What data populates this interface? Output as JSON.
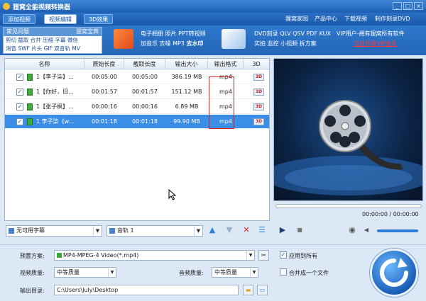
{
  "window": {
    "title": "狸窝全能视频转换器",
    "controls": [
      "_",
      "□",
      "×"
    ]
  },
  "menu": {
    "tabs": [
      "添加视频",
      "视频编辑",
      "3D效果"
    ],
    "links": [
      "狸窝家园",
      "产品中心",
      "下载视频",
      "制作刻录DVD"
    ]
  },
  "banner": {
    "faq_title": "常见问题",
    "faq_right": "狸窝宝典",
    "faq_line1": "剪切 截取 合并 压缩 字幕 微信",
    "faq_line2": "消音 SWF 片头 GIF 双音轨 MV",
    "group1_line1": "电子相册 照片 PPT转视频",
    "group1_line2_a": "加音乐 去噪 MP3",
    "group1_line2_b": "去水印",
    "group2_line1": "DVD刻录 QLV QSV PDF KUX",
    "group2_line2": "实拍 监控 小视频 拆方案",
    "vip_line1": "VIP用户-拥有狸窝所有软件",
    "vip_line2": "点此升级VIP会员"
  },
  "list": {
    "headers": [
      "名称",
      "原始长度",
      "截取长度",
      "输出大小",
      "输出格式",
      "3D"
    ],
    "rows": [
      {
        "name": "1【李子柒】...",
        "orig": "00:05:00",
        "cut": "00:05:00",
        "size": "386.19 MB",
        "fmt": "mp4",
        "selected": false
      },
      {
        "name": "1【你好，旧...",
        "orig": "00:01:57",
        "cut": "00:01:57",
        "size": "151.12 MB",
        "fmt": "mp4",
        "selected": false
      },
      {
        "name": "1【张子枫】...",
        "orig": "00:00:16",
        "cut": "00:00:16",
        "size": "6.89 MB",
        "fmt": "mp4",
        "selected": false
      },
      {
        "name": "1 李子柒《w...",
        "orig": "00:01:18",
        "cut": "00:01:18",
        "size": "99.90 MB",
        "fmt": "mp4",
        "selected": true
      }
    ],
    "badge_3d": "3D"
  },
  "list_tools": {
    "subtitle": "无可用字幕",
    "audio_track": "音轨 1"
  },
  "preview": {
    "time": "00:00:00 / 00:00:00"
  },
  "options": {
    "preset_label": "预置方案:",
    "preset_value": "MP4-MPEG-4 Video(*.mp4)",
    "apply_all": "应用到所有",
    "video_quality_label": "视频质量:",
    "video_quality": "中等质量",
    "audio_quality_label": "音频质量:",
    "audio_quality": "中等质量",
    "merge": "合并成一个文件",
    "output_label": "输出目录:",
    "output_path": "C:\\Users\\July\\Desktop"
  },
  "colors": {
    "accent": "#2466b8",
    "selected_row": "#3b8ee6",
    "highlight_box": "#d42020",
    "vip_link": "#ff3b3b"
  },
  "icons": [
    "app-icon",
    "ppt-icon",
    "phone-icon",
    "film-reel-icon",
    "play-icon",
    "stop-icon",
    "camera-icon",
    "volume-icon",
    "arrow-up-icon",
    "arrow-down-icon",
    "delete-icon",
    "list-icon",
    "scissors-icon",
    "folder-icon",
    "convert-icon"
  ]
}
